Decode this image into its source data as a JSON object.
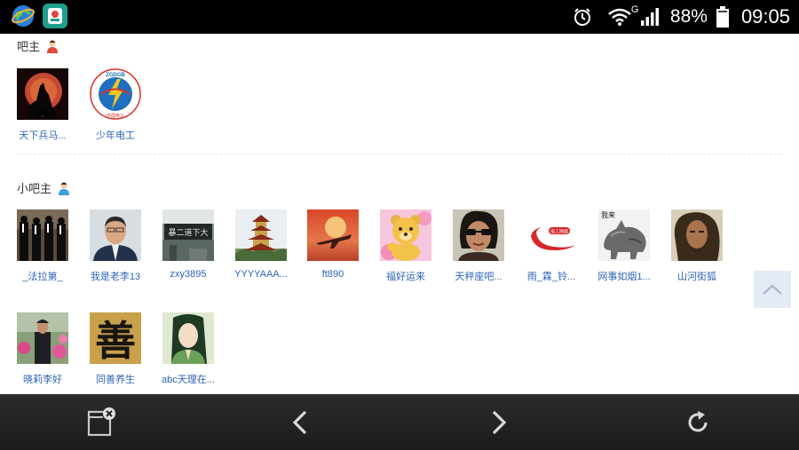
{
  "status_bar": {
    "network_type": "G",
    "battery_percent": "88%",
    "time": "09:05",
    "app_icons": [
      "browser-globe-icon",
      "app-icon"
    ]
  },
  "sections": {
    "owners": {
      "heading": "吧主",
      "users": [
        {
          "name": "天下兵马..."
        },
        {
          "name": "少年电工"
        }
      ]
    },
    "assistants": {
      "heading": "小吧主",
      "users": [
        {
          "name": "_法拉第_"
        },
        {
          "name": "我是老李13"
        },
        {
          "name": "zxy3895"
        },
        {
          "name": "YYYYAAA..."
        },
        {
          "name": "ft890"
        },
        {
          "name": "福好运来"
        },
        {
          "name": "天秤座吧..."
        },
        {
          "name": "雨_霖_铃..."
        },
        {
          "name": "网事如烟1..."
        },
        {
          "name": "山河街狐"
        },
        {
          "name": "晓莉李好"
        },
        {
          "name": "同善养生"
        },
        {
          "name": "abc天理在..."
        }
      ]
    }
  },
  "avatar_texts": {
    "shaonian_logo": "ZGDGB",
    "shaonian_sub": "中国电工",
    "calligraphy": "善",
    "banner": "电工网络",
    "stone_sign": "我来",
    "tablet": "暴二道下大"
  },
  "navbar": {
    "items": [
      "close-tab-icon",
      "back-icon",
      "forward-icon",
      "refresh-icon"
    ]
  },
  "colors": {
    "link": "#2d64b3",
    "statusbar_bg": "#000000",
    "navbar_bg": "#222222",
    "backtop_bg": "#e3ebf5"
  }
}
